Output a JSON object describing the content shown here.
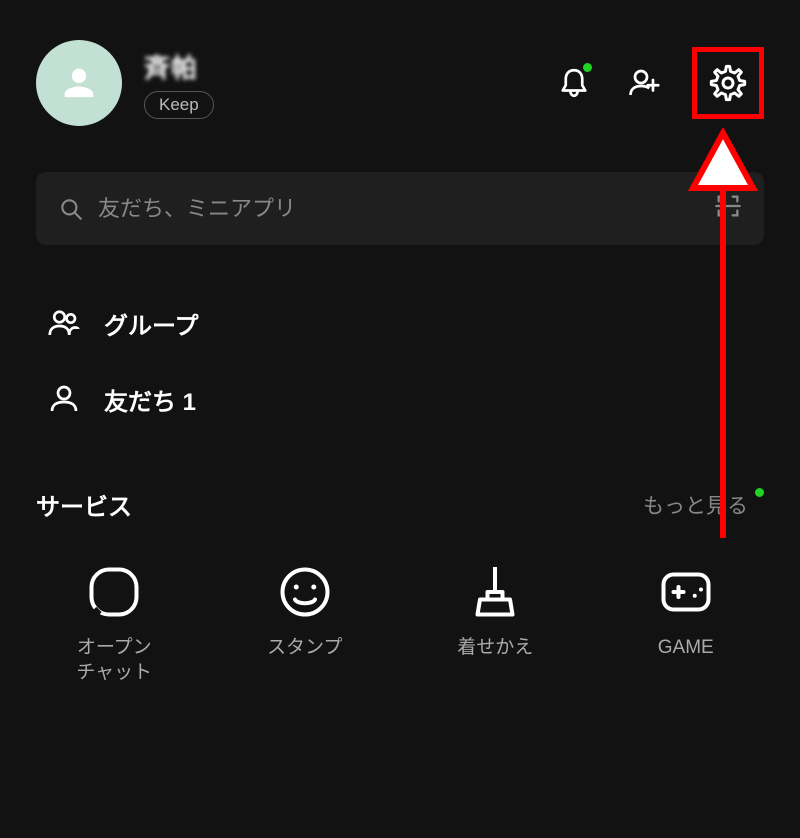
{
  "header": {
    "user_name": "斉帕",
    "keep_label": "Keep"
  },
  "search": {
    "placeholder": "友だち、ミニアプリ"
  },
  "list": {
    "items": [
      {
        "label": "グループ",
        "icon": "group-icon"
      },
      {
        "label": "友だち 1",
        "icon": "friend-icon"
      }
    ]
  },
  "services": {
    "title": "サービス",
    "more_label": "もっと見る",
    "items": [
      {
        "label": "オープン\nチャット",
        "icon": "openchat-icon"
      },
      {
        "label": "スタンプ",
        "icon": "stamp-icon"
      },
      {
        "label": "着せかえ",
        "icon": "theme-icon"
      },
      {
        "label": "GAME",
        "icon": "game-icon"
      }
    ]
  }
}
